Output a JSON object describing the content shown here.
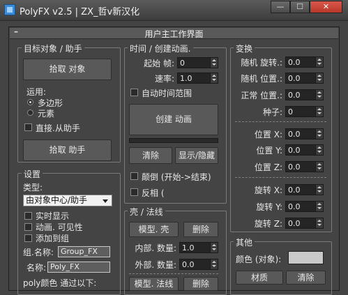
{
  "window": {
    "title": "PolyFX v2.5 | ZX_哲v新汉化",
    "min_label": "—",
    "max_label": "☐",
    "close_label": "✕"
  },
  "rollout": {
    "collapse_symbol": "–",
    "title": "用户主工作界面"
  },
  "target": {
    "title": "目标对象 / 助手",
    "pick_object_button": "拾取 对象",
    "apply_label": "运用:",
    "radio_poly": "多边形",
    "radio_elements": "元素",
    "from_helper_label": "直接.从助手",
    "pick_helper_button": "拾取 助手"
  },
  "time": {
    "title": "时间 / 创建动画.",
    "start_label": "起始 帧:",
    "start_value": "0",
    "rate_label": "速率:",
    "rate_value": "1.0",
    "auto_range_label": "自动时间范围",
    "create_button": "创建 动画",
    "delete_button": "清除",
    "show_hide_button": "显示/隐藏",
    "reverse_label": "颠倒 (开始->结束)",
    "invert_label": "反相 ("
  },
  "transform": {
    "title": "变换",
    "rand_rot_label": "随机 旋转.:",
    "rand_rot_value": "0.0",
    "rand_pos_label": "随机 位置.:",
    "rand_pos_value": "0.0",
    "normal_pos_label": "正常 位置.:",
    "normal_pos_value": "0.0",
    "seed_label": "种子:",
    "seed_value": "0",
    "pos_x_label": "位置 X:",
    "pos_x_value": "0.0",
    "pos_y_label": "位置 Y:",
    "pos_y_value": "0.0",
    "pos_z_label": "位置 Z:",
    "pos_z_value": "0.0",
    "rot_x_label": "旋转 X:",
    "rot_x_value": "0.0",
    "rot_y_label": "旋转 Y:",
    "rot_y_value": "0.0",
    "rot_z_label": "旋转 Z:",
    "rot_z_value": "0.0"
  },
  "settings": {
    "title": "设置",
    "type_label": "类型:",
    "type_value": "由对象中心/助手",
    "realtime_label": "实时显示",
    "anim_visibility_label": "动画. 可见性",
    "add_to_group_label": "添加到组",
    "group_name_label": "组.名称:",
    "group_name_value": "Group_FX",
    "name_label": "名称:",
    "name_value": "Poly_FX",
    "poly_color_label": "poly颜色 通过以下:"
  },
  "shell": {
    "title": "壳 / 法线",
    "model_shell_button": "模型. 壳",
    "delete_button_1": "删除",
    "inner_label": "内部. 数量:",
    "inner_value": "1.0",
    "outer_label": "外部. 数量:",
    "outer_value": "0.0",
    "model_normal_button": "模型. 法线",
    "delete_button_2": "删除"
  },
  "other": {
    "title": "其他",
    "color_label": "颜色 (对象):",
    "material_button": "材质",
    "clear_button": "清除"
  },
  "colors": {
    "color_swatch": "#c9c9c9",
    "close_button": "#c8392e"
  }
}
